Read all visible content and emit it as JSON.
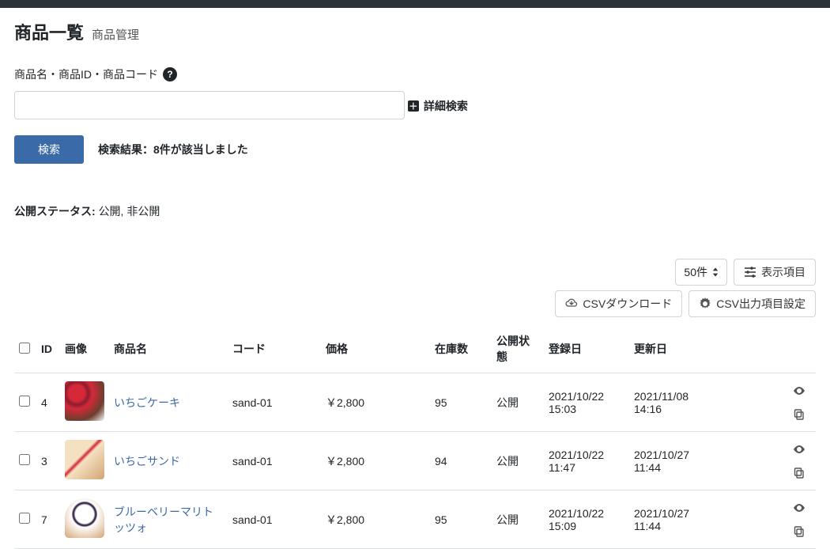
{
  "header": {
    "title": "商品一覧",
    "subtitle": "商品管理"
  },
  "search": {
    "label": "商品名・商品ID・商品コード",
    "value": "",
    "advanced_label": "詳細検索",
    "button_label": "検索",
    "result_text": "検索結果：8件が該当しました"
  },
  "status": {
    "label": "公開ステータス:",
    "value": "公開, 非公開"
  },
  "toolbar": {
    "per_page": "50件",
    "columns_label": "表示項目",
    "csv_download": "CSVダウンロード",
    "csv_settings": "CSV出力項目設定"
  },
  "table": {
    "headers": {
      "id": "ID",
      "image": "画像",
      "name": "商品名",
      "code": "コード",
      "price": "価格",
      "stock": "在庫数",
      "public": "公開状態",
      "created": "登録日",
      "updated": "更新日"
    },
    "rows": [
      {
        "id": "4",
        "name": "いちごケーキ",
        "code": "sand-01",
        "price": "￥2,800",
        "stock": "95",
        "public": "公開",
        "created": "2021/10/22 15:03",
        "updated": "2021/11/08 14:16",
        "thumb_class": "cake"
      },
      {
        "id": "3",
        "name": "いちごサンド",
        "code": "sand-01",
        "price": "￥2,800",
        "stock": "94",
        "public": "公開",
        "created": "2021/10/22 11:47",
        "updated": "2021/10/27 11:44",
        "thumb_class": "sand"
      },
      {
        "id": "7",
        "name": "ブルーベリーマリトッツォ",
        "code": "sand-01",
        "price": "￥2,800",
        "stock": "95",
        "public": "公開",
        "created": "2021/10/22 15:09",
        "updated": "2021/10/27 11:44",
        "thumb_class": "berry"
      }
    ]
  }
}
